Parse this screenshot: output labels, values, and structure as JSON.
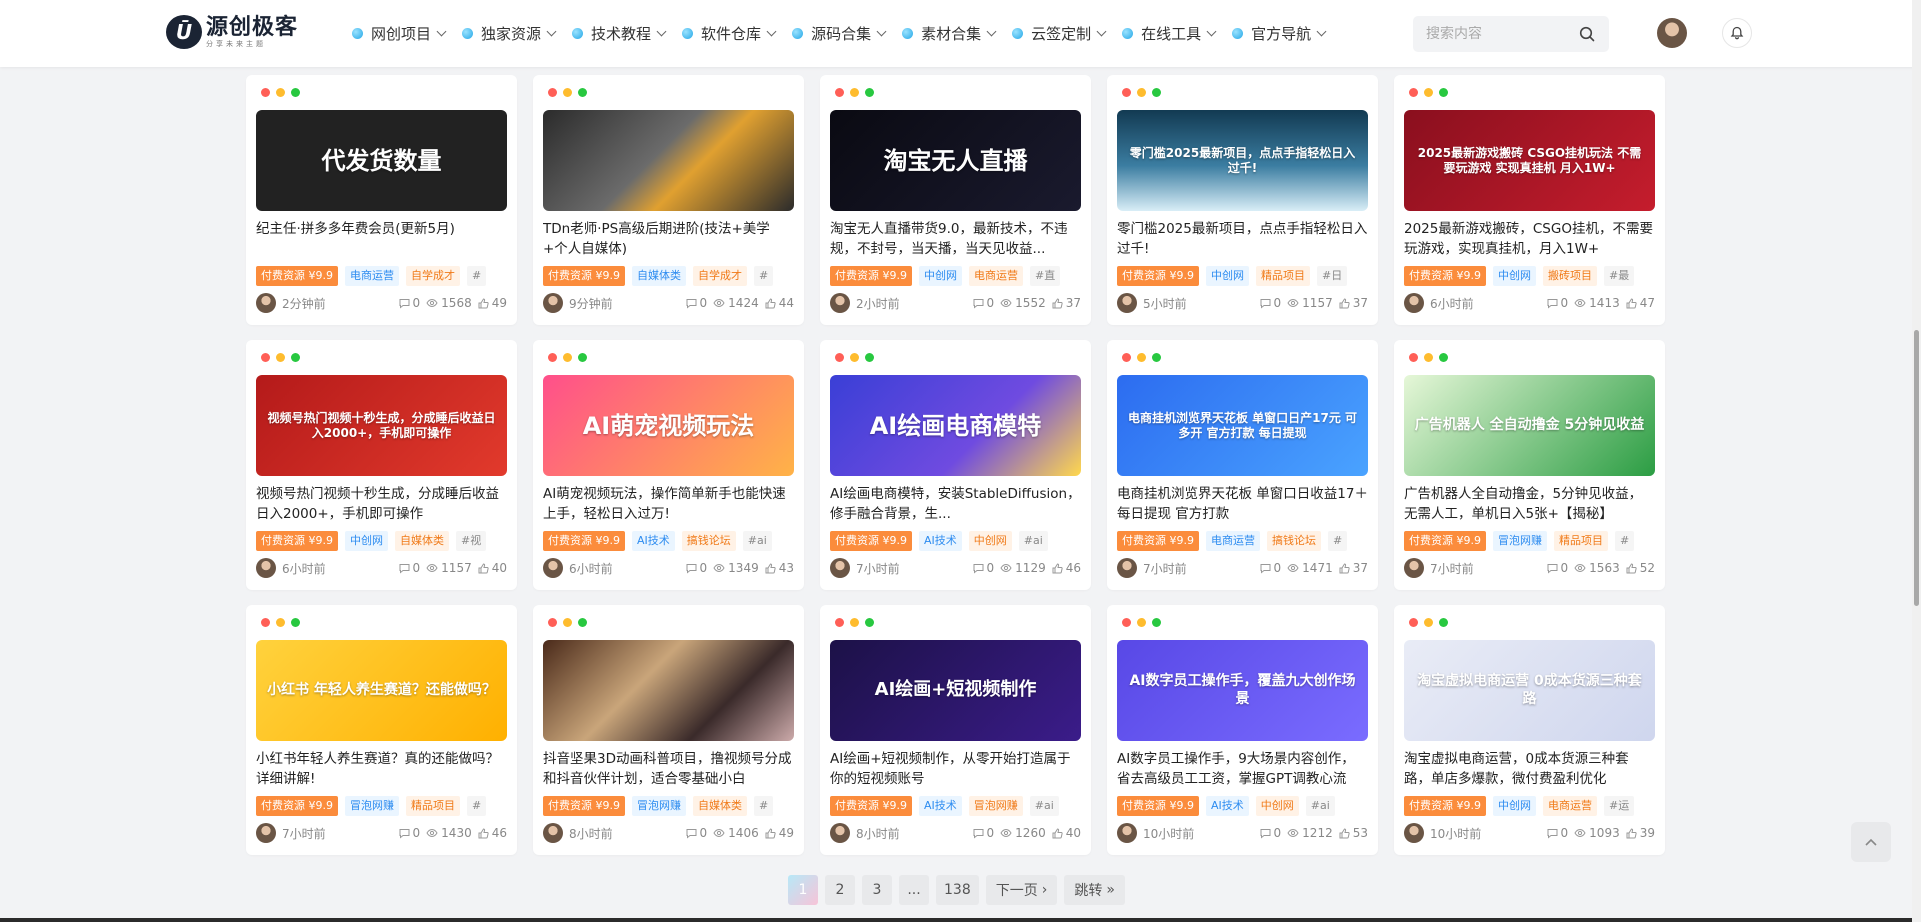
{
  "brand": {
    "mark": "Ū",
    "name": "源创极客",
    "slogan": "分享未来主题"
  },
  "nav": [
    "网创项目",
    "独家资源",
    "技术教程",
    "软件仓库",
    "源码合集",
    "素材合集",
    "云签定制",
    "在线工具",
    "官方导航"
  ],
  "search": {
    "placeholder": "搜索内容"
  },
  "cards": [
    {
      "thumb": "代发货数量",
      "bg": "#222",
      "title": "纪主任·拼多多年费会员(更新5月)",
      "tags": [
        "付费资源 ¥9.9",
        "电商运营",
        "自学成才",
        "#"
      ],
      "time": "2分钟前",
      "c": "0",
      "v": "1568",
      "l": "49"
    },
    {
      "thumb": "",
      "bg": "linear-gradient(135deg,#2b2b2b,#6b6b6b 45%,#e0a030 60%,#2b2b2b)",
      "title": "TDn老师·PS高级后期进阶(技法+美学+个人自媒体)",
      "tags": [
        "付费资源 ¥9.9",
        "自媒体类",
        "自学成才",
        "#"
      ],
      "time": "9分钟前",
      "c": "0",
      "v": "1424",
      "l": "44"
    },
    {
      "thumb": "淘宝无人直播",
      "bg": "linear-gradient(135deg,#0a0a12,#1a1a2e)",
      "title": "淘宝无人直播带货9.0，最新技术，不违规，不封号，当天播，当天见收益...",
      "tags": [
        "付费资源 ¥9.9",
        "中创网",
        "电商运营",
        "#直"
      ],
      "time": "2小时前",
      "c": "0",
      "v": "1552",
      "l": "37"
    },
    {
      "thumb": "零门槛2025最新项目，点点手指轻松日入过千!",
      "bg": "linear-gradient(180deg,#123a52,#3b7da1 55%,#d9eef7)",
      "title": "零门槛2025最新项目，点点手指轻松日入过千!",
      "tags": [
        "付费资源 ¥9.9",
        "中创网",
        "精品项目",
        "#日"
      ],
      "time": "5小时前",
      "c": "0",
      "v": "1157",
      "l": "37"
    },
    {
      "thumb": "2025最新游戏搬砖 CSGO挂机玩法 不需要玩游戏 实现真挂机 月入1W+",
      "bg": "linear-gradient(135deg,#8a0f1e,#c51d2d)",
      "title": "2025最新游戏搬砖，CSGO挂机，不需要玩游戏，实现真挂机，月入1W+",
      "tags": [
        "付费资源 ¥9.9",
        "中创网",
        "搬砖项目",
        "#最"
      ],
      "time": "6小时前",
      "c": "0",
      "v": "1413",
      "l": "47"
    },
    {
      "thumb": "视频号热门视频十秒生成，分成睡后收益日入2000+，手机即可操作",
      "bg": "linear-gradient(135deg,#b41a1a,#e23a2c)",
      "title": "视频号热门视频十秒生成，分成睡后收益日入2000+，手机即可操作",
      "tags": [
        "付费资源 ¥9.9",
        "中创网",
        "自媒体类",
        "#视"
      ],
      "time": "6小时前",
      "c": "0",
      "v": "1157",
      "l": "40"
    },
    {
      "thumb": "AI萌宠视频玩法",
      "bg": "linear-gradient(135deg,#ff4f8b,#ffb347)",
      "title": "AI萌宠视频玩法，操作简单新手也能快速上手，轻松日入过万!",
      "tags": [
        "付费资源 ¥9.9",
        "AI技术",
        "搞钱论坛",
        "#ai"
      ],
      "time": "6小时前",
      "c": "0",
      "v": "1349",
      "l": "43"
    },
    {
      "thumb": "AI绘画电商模特",
      "bg": "linear-gradient(135deg,#3a3fd6,#6f4be0 60%,#ffd84d)",
      "title": "AI绘画电商模特，安装StableDiffusion，修手融合背景，生...",
      "tags": [
        "付费资源 ¥9.9",
        "AI技术",
        "中创网",
        "#ai"
      ],
      "time": "7小时前",
      "c": "0",
      "v": "1129",
      "l": "46"
    },
    {
      "thumb": "电商挂机浏览界天花板 单窗口日产17元 可多开 官方打款 每日提现",
      "bg": "linear-gradient(135deg,#2c6cf0,#4aa3ff)",
      "title": "电商挂机浏览界天花板 单窗口日收益17＋ 每日提现 官方打款",
      "tags": [
        "付费资源 ¥9.9",
        "电商运营",
        "搞钱论坛",
        "#"
      ],
      "time": "7小时前",
      "c": "0",
      "v": "1471",
      "l": "37"
    },
    {
      "thumb": "广告机器人 全自动撸金 5分钟见收益",
      "bg": "linear-gradient(135deg,#e6f7d8,#2b9d43)",
      "title": "广告机器人全自动撸金，5分钟见收益，无需人工，单机日入5张+【揭秘】",
      "tags": [
        "付费资源 ¥9.9",
        "冒泡网赚",
        "精品项目",
        "#"
      ],
      "time": "7小时前",
      "c": "0",
      "v": "1563",
      "l": "52"
    },
    {
      "thumb": "小红书 年轻人养生赛道？还能做吗？",
      "bg": "linear-gradient(135deg,#ffd23d,#ffb000)",
      "title": "小红书年轻人养生赛道？真的还能做吗？详细讲解!",
      "tags": [
        "付费资源 ¥9.9",
        "冒泡网赚",
        "精品项目",
        "#"
      ],
      "time": "7小时前",
      "c": "0",
      "v": "1430",
      "l": "46"
    },
    {
      "thumb": "",
      "bg": "linear-gradient(135deg,#4a2a1a,#c9a57a 40%,#3a2a2a 70%,#caa)",
      "title": "抖音坚果3D动画科普项目，撸视频号分成和抖音伙伴计划，适合零基础小白",
      "tags": [
        "付费资源 ¥9.9",
        "冒泡网赚",
        "自媒体类",
        "#"
      ],
      "time": "8小时前",
      "c": "0",
      "v": "1406",
      "l": "49"
    },
    {
      "thumb": "AI绘画+短视频制作",
      "bg": "linear-gradient(135deg,#1c1147,#3b1c8a)",
      "title": "AI绘画+短视频制作，从零开始打造属于你的短视频账号",
      "tags": [
        "付费资源 ¥9.9",
        "AI技术",
        "冒泡网赚",
        "#ai"
      ],
      "time": "8小时前",
      "c": "0",
      "v": "1260",
      "l": "40"
    },
    {
      "thumb": "AI数字员工操作手，覆盖九大创作场景",
      "bg": "linear-gradient(135deg,#5848e6,#7a6cff)",
      "title": "AI数字员工操作手，9大场景内容创作，省去高级员工工资，掌握GPT调教心流",
      "tags": [
        "付费资源 ¥9.9",
        "AI技术",
        "中创网",
        "#ai"
      ],
      "time": "10小时前",
      "c": "0",
      "v": "1212",
      "l": "53"
    },
    {
      "thumb": "淘宝虚拟电商运营 0成本货源三种套路",
      "bg": "linear-gradient(135deg,#e9ecf6,#cfd6ee)",
      "title": "淘宝虚拟电商运营，0成本货源三种套路，单店多爆款，微付费盈利优化",
      "tags": [
        "付费资源 ¥9.9",
        "中创网",
        "电商运营",
        "#运"
      ],
      "time": "10小时前",
      "c": "0",
      "v": "1093",
      "l": "39"
    }
  ],
  "pagination": [
    "1",
    "2",
    "3",
    "...",
    "138",
    "下一页",
    "跳转"
  ],
  "colors": {
    "accent": "#23a6e6",
    "pay_tag": "#fb8c3c",
    "blue_tag": "#2d8cf0",
    "orange_tag": "#f07a18"
  }
}
